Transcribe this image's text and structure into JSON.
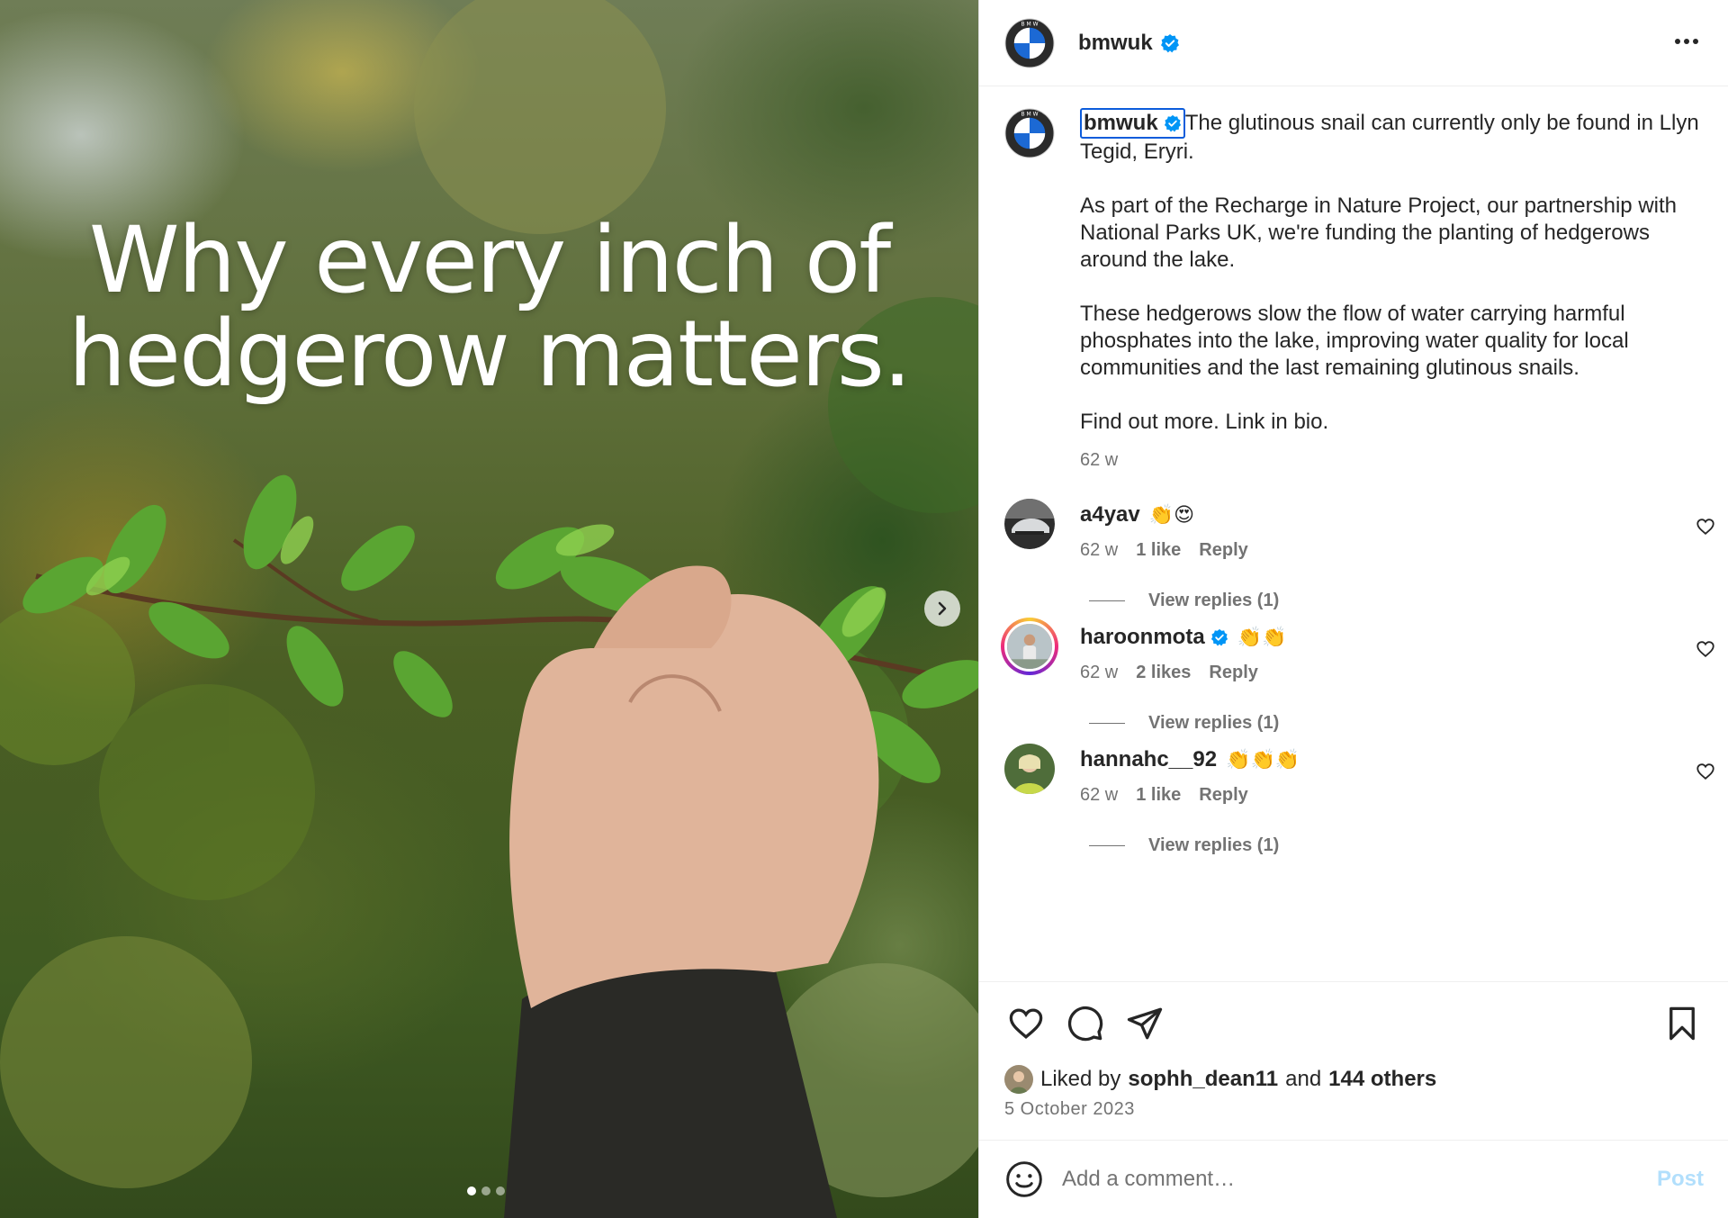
{
  "media": {
    "headline_line1": "Why every inch of",
    "headline_line2": "hedgerow matters.",
    "next_icon": "chevron-right-icon",
    "slides": 3,
    "active_slide": 1
  },
  "header": {
    "username": "bmwuk",
    "verified": true,
    "more_icon": "more-horizontal-icon"
  },
  "caption": {
    "username": "bmwuk",
    "paragraphs": [
      "The glutinous snail can currently only be found in Llyn Tegid, Eryri.",
      "As part of the Recharge in Nature Project, our partnership with National Parks UK, we're funding the planting of hedgerows around the lake.",
      "These hedgerows slow the flow of water carrying harmful phosphates into the lake, improving water quality for local communities and the last remaining glutinous snails.",
      "Find out more. Link in bio."
    ],
    "time": "62 w"
  },
  "comments": [
    {
      "username": "a4yav",
      "verified": false,
      "text": "👏😍",
      "time": "62 w",
      "likes": "1 like",
      "reply_label": "Reply",
      "view_replies": "View replies (1)"
    },
    {
      "username": "haroonmota",
      "verified": true,
      "text": "👏👏",
      "time": "62 w",
      "likes": "2 likes",
      "reply_label": "Reply",
      "view_replies": "View replies (1)"
    },
    {
      "username": "hannahc__92",
      "verified": false,
      "text": "👏👏👏",
      "time": "62 w",
      "likes": "1 like",
      "reply_label": "Reply",
      "view_replies": "View replies (1)"
    }
  ],
  "actions": {
    "liked_by_prefix": "Liked by",
    "liked_by_user": "sophh_dean11",
    "liked_by_and": "and",
    "liked_by_others": "144 others",
    "date": "5 October 2023"
  },
  "add_comment": {
    "placeholder": "Add a comment…",
    "post_label": "Post"
  },
  "colors": {
    "verified_blue": "#0095f6",
    "muted_text": "#737373",
    "post_disabled": "#b2dffc",
    "focus_outline": "#0c5cdb"
  }
}
